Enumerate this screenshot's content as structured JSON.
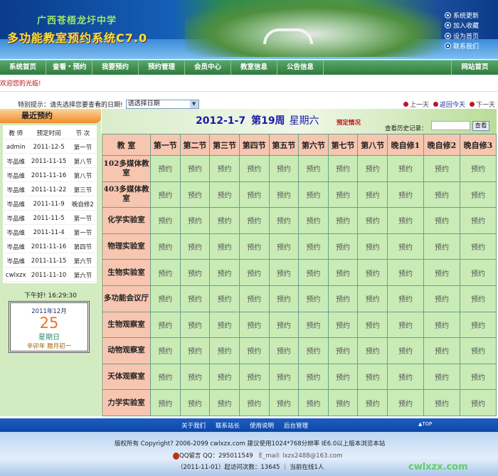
{
  "header": {
    "school": "广西苍梧龙圩中学",
    "system_title": "多功能教室预约系统C7.0",
    "site": "cwlxzx.com",
    "links": [
      "系统更新",
      "加入收藏",
      "设为首页",
      "联系我们"
    ]
  },
  "nav": {
    "items": [
      "系统首页",
      "查看・预约",
      "我要预约",
      "预约管理",
      "会员中心",
      "教室信息",
      "公告信息"
    ],
    "home": "网站首页"
  },
  "welcome": "欢迎您的光临!",
  "hint": {
    "label": "特别提示：请先选择您要查看的日期!",
    "select_value": "请选择日期"
  },
  "daynav": {
    "prev": "上一天",
    "today": "返回今天",
    "next": "下一天"
  },
  "recent": {
    "title": "最近预约",
    "headers": [
      "教 师",
      "预定时间",
      "节 次"
    ],
    "rows": [
      [
        "admin",
        "2011-12-5",
        "第一节"
      ],
      [
        "岑品维",
        "2011-11-15",
        "第八节"
      ],
      [
        "岑品维",
        "2011-11-16",
        "第八节"
      ],
      [
        "岑品维",
        "2011-11-22",
        "第三节"
      ],
      [
        "岑品维",
        "2011-11-9",
        "晚自修2"
      ],
      [
        "岑品维",
        "2011-11-5",
        "第一节"
      ],
      [
        "岑品维",
        "2011-11-4",
        "第一节"
      ],
      [
        "岑品维",
        "2011-11-16",
        "第四节"
      ],
      [
        "岑品维",
        "2011-11-15",
        "第六节"
      ],
      [
        "cwlxzx",
        "2011-11-10",
        "第六节"
      ]
    ]
  },
  "greeting": "下午好! 16:29:30",
  "calendar": {
    "year_month": "2011年12月",
    "day": "25",
    "weekday": "星期日",
    "lunar": "辛卯年 腊月初一"
  },
  "main": {
    "date": "2012-1-7",
    "week": "第19周",
    "weekday": "星期六",
    "status": "预定情况",
    "history_label": "查看历史记录：",
    "history_button": "查看",
    "room_header": "教 室",
    "slots": [
      "第一节",
      "第二节",
      "第三节",
      "第四节",
      "第五节",
      "第六节",
      "第七节",
      "第八节",
      "晚自修1",
      "晚自修2",
      "晚自修3"
    ],
    "rooms": [
      "102多媒体教室",
      "403多媒体教室",
      "化学实验室",
      "物理实验室",
      "生物实验室",
      "多功能会议厅",
      "生物观察室",
      "动物观察室",
      "天体观察室",
      "力学实验室"
    ],
    "cell_label": "预约"
  },
  "footer": {
    "links": [
      "关于我们",
      "联系站长",
      "使用说明",
      "后台管理"
    ],
    "top": "▲TOP",
    "copyright": "版权所有 Copyright? 2006-2099 cwlxzx.com 建议使用1024*768分辨率 IE6.0以上版本浏览本站",
    "qq_label": "QQ留言",
    "qq": "QQ：295011549",
    "email": "E_mail: lxzx2488@163.com",
    "visits": "（2011-11-01）起访问次数：13645 ｜ 当前在线1人",
    "watermark": "cwlxzx.com"
  }
}
